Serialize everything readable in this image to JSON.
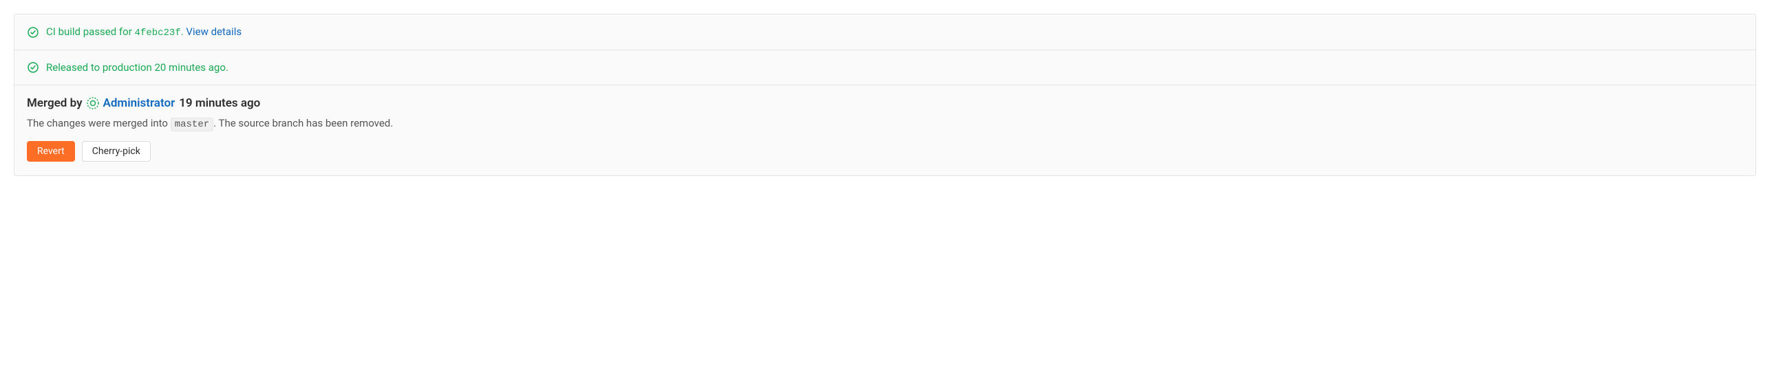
{
  "ci_status": {
    "text_prefix": "CI build passed for ",
    "commit_sha": "4febc23f",
    "separator": ". ",
    "details_link": "View details"
  },
  "release_status": {
    "text": "Released to production 20 minutes ago."
  },
  "merged": {
    "prefix": "Merged by",
    "user_name": "Administrator",
    "time_ago": "19 minutes ago",
    "desc_prefix": "The changes were merged into ",
    "branch": "master",
    "desc_suffix": ". The source branch has been removed."
  },
  "buttons": {
    "revert": "Revert",
    "cherry_pick": "Cherry-pick"
  }
}
